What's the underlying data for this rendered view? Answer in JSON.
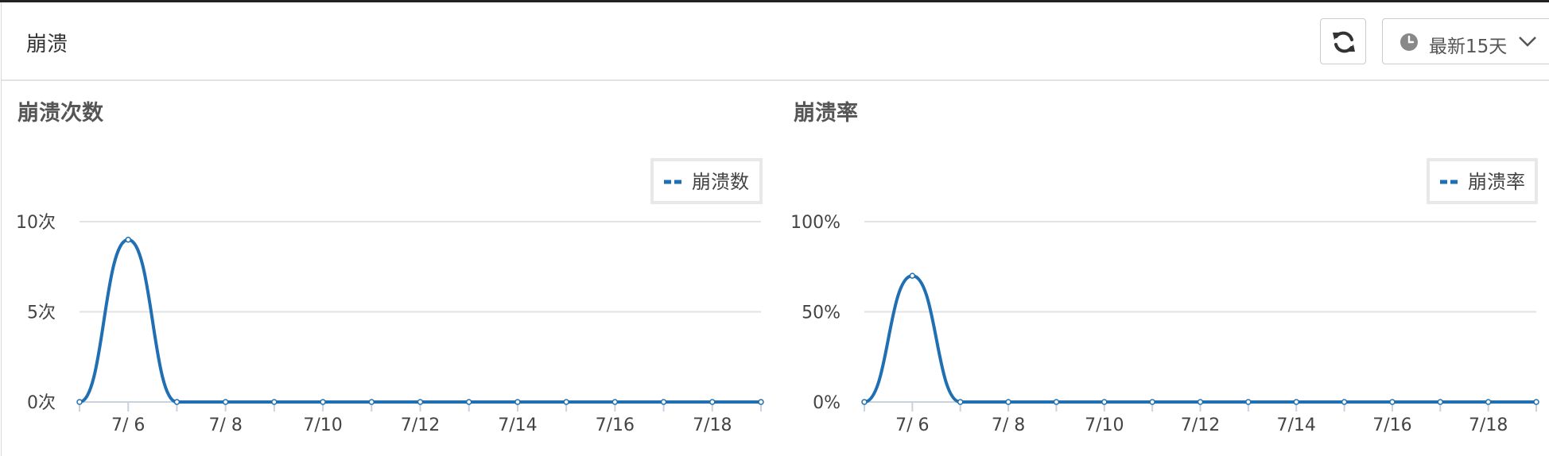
{
  "header": {
    "title": "崩溃",
    "range_label": "最新15天"
  },
  "chart_data": [
    {
      "type": "line",
      "title": "崩溃次数",
      "x": [
        "7/5",
        "7/6",
        "7/7",
        "7/8",
        "7/9",
        "7/10",
        "7/11",
        "7/12",
        "7/13",
        "7/14",
        "7/15",
        "7/16",
        "7/17",
        "7/18",
        "7/19"
      ],
      "xtick_labels": [
        "7/ 6",
        "7/ 8",
        "7/10",
        "7/12",
        "7/14",
        "7/16",
        "7/18"
      ],
      "ytick_labels": [
        "0次",
        "5次",
        "10次"
      ],
      "ylim": [
        0,
        10
      ],
      "series": [
        {
          "name": "崩溃数",
          "values": [
            0,
            9,
            0,
            0,
            0,
            0,
            0,
            0,
            0,
            0,
            0,
            0,
            0,
            0,
            0
          ],
          "color": "#1f6fb2"
        }
      ],
      "legend": "top-right",
      "grid": true
    },
    {
      "type": "line",
      "title": "崩溃率",
      "x": [
        "7/5",
        "7/6",
        "7/7",
        "7/8",
        "7/9",
        "7/10",
        "7/11",
        "7/12",
        "7/13",
        "7/14",
        "7/15",
        "7/16",
        "7/17",
        "7/18",
        "7/19"
      ],
      "xtick_labels": [
        "7/ 6",
        "7/ 8",
        "7/10",
        "7/12",
        "7/14",
        "7/16",
        "7/18"
      ],
      "ytick_labels": [
        "0%",
        "50%",
        "100%"
      ],
      "ylim": [
        0,
        100
      ],
      "series": [
        {
          "name": "崩溃率",
          "values": [
            0,
            70,
            0,
            0,
            0,
            0,
            0,
            0,
            0,
            0,
            0,
            0,
            0,
            0,
            0
          ],
          "color": "#1f6fb2"
        }
      ],
      "legend": "top-right",
      "grid": true
    }
  ]
}
